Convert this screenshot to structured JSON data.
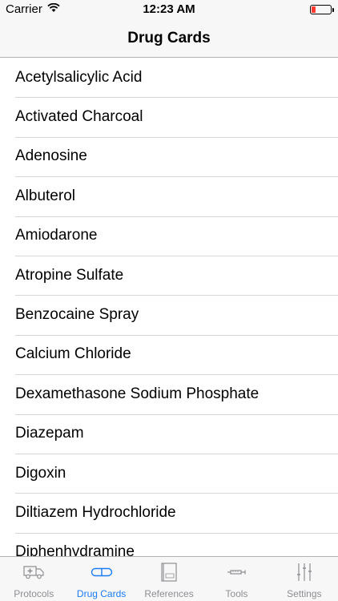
{
  "status_bar": {
    "carrier": "Carrier",
    "time": "12:23 AM",
    "battery_level_percent": 20,
    "battery_color": "#ff3b30"
  },
  "nav": {
    "title": "Drug Cards"
  },
  "list": {
    "items": [
      "Acetylsalicylic Acid",
      "Activated Charcoal",
      "Adenosine",
      "Albuterol",
      "Amiodarone",
      "Atropine Sulfate",
      "Benzocaine Spray",
      "Calcium Chloride",
      "Dexamethasone Sodium Phosphate",
      "Diazepam",
      "Digoxin",
      "Diltiazem Hydrochloride",
      "Diphenhydramine"
    ]
  },
  "tab_bar": {
    "active_color": "#1a7cf5",
    "inactive_color": "#8e8e93",
    "tabs": [
      {
        "label": "Protocols",
        "icon": "ambulance-icon"
      },
      {
        "label": "Drug Cards",
        "icon": "pill-icon"
      },
      {
        "label": "References",
        "icon": "book-icon"
      },
      {
        "label": "Tools",
        "icon": "syringe-icon"
      },
      {
        "label": "Settings",
        "icon": "sliders-icon"
      }
    ]
  }
}
